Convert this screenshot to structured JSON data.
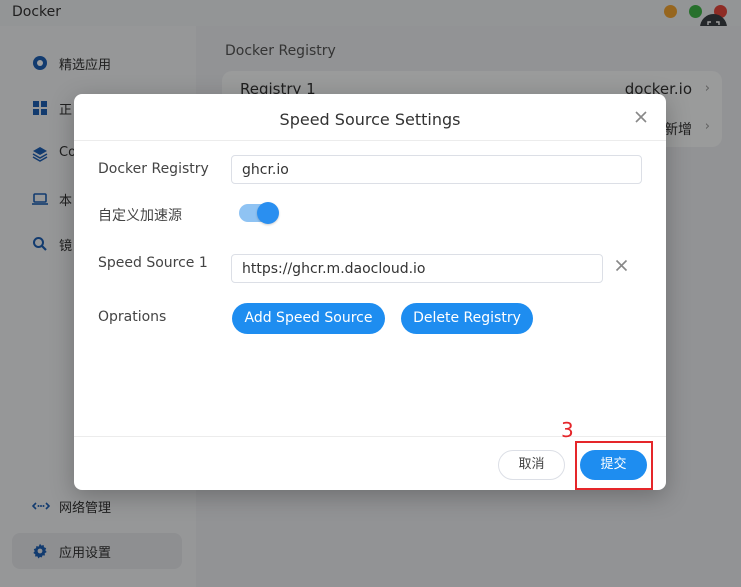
{
  "window": {
    "title": "Docker",
    "fullscreen_icon": "fullscreen-icon"
  },
  "sidebar": {
    "items": [
      {
        "icon": "featured-apps-icon",
        "label": "精选应用"
      },
      {
        "icon": "apps-icon",
        "label": "正"
      },
      {
        "icon": "layers-icon",
        "label": "Co"
      },
      {
        "icon": "monitor-icon",
        "label": "本"
      },
      {
        "icon": "search-icon",
        "label": "镜"
      }
    ],
    "bottom_items": [
      {
        "icon": "network-icon",
        "label": "网络管理"
      },
      {
        "icon": "gear-icon",
        "label": "应用设置"
      }
    ]
  },
  "main": {
    "title": "Docker Registry",
    "registry": {
      "name": "Registry 1",
      "value": "docker.io",
      "add_label": "新增"
    }
  },
  "modal": {
    "title": "Speed Source Settings",
    "registry_label": "Docker Registry",
    "registry_value": "ghcr.io",
    "custom_accel_label": "自定义加速源",
    "custom_accel_enabled": true,
    "speed_source_label": "Speed Source 1",
    "speed_source_value": "https://ghcr.m.daocloud.io",
    "operations_label": "Oprations",
    "add_source_button": "Add Speed Source",
    "delete_registry_button": "Delete Registry",
    "cancel_button": "取消",
    "submit_button": "提交"
  },
  "annotation": {
    "step_number": "3",
    "color": "#e5262a"
  }
}
